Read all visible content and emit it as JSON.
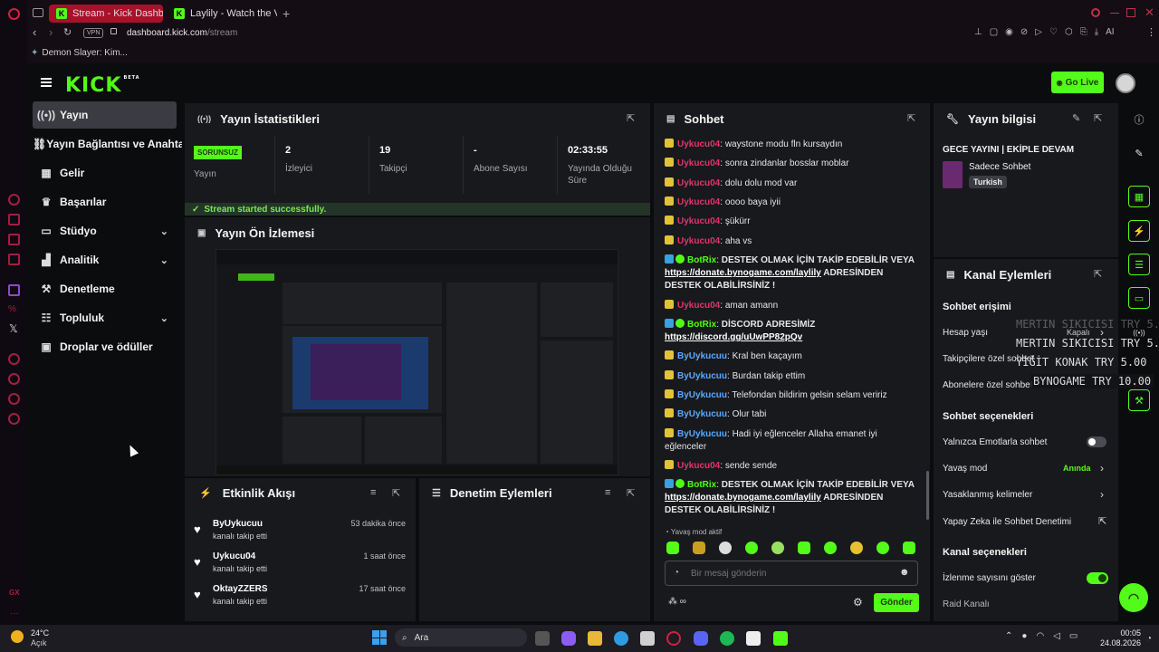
{
  "browser": {
    "tabs": [
      {
        "label": "Stream - Kick Dashboard",
        "active": true
      },
      {
        "label": "Laylily - Watch the VOD on",
        "active": false
      }
    ],
    "new_tab": "+",
    "address": {
      "vpn": "VPN",
      "domain": "dashboard.kick.com",
      "path": "/stream"
    },
    "bookmark": "Demon Slayer: Kim...",
    "ai_label": "AI"
  },
  "header": {
    "logo": "KICK",
    "beta": "BETA",
    "go_live": "Go Live"
  },
  "sidebar": {
    "items": [
      {
        "label": "Yayın",
        "icon": "broadcast-icon",
        "active": true
      },
      {
        "label": "Yayın Bağlantısı ve Anahtar",
        "icon": "link-icon"
      },
      {
        "label": "Gelir",
        "icon": "revenue-icon"
      },
      {
        "label": "Başarılar",
        "icon": "trophy-icon"
      },
      {
        "label": "Stüdyo",
        "icon": "studio-icon",
        "expandable": true
      },
      {
        "label": "Analitik",
        "icon": "analytics-icon",
        "expandable": true
      },
      {
        "label": "Denetleme",
        "icon": "moderation-icon"
      },
      {
        "label": "Topluluk",
        "icon": "community-icon",
        "expandable": true
      },
      {
        "label": "Droplar ve ödüller",
        "icon": "drops-icon"
      }
    ]
  },
  "stats": {
    "title": "Yayın İstatistikleri",
    "status_badge": "SORUNSUZ",
    "cells": [
      {
        "value": "",
        "label": "Yayın"
      },
      {
        "value": "2",
        "label": "İzleyici"
      },
      {
        "value": "19",
        "label": "Takipçi"
      },
      {
        "value": "-",
        "label": "Abone Sayısı"
      },
      {
        "value": "02:33:55",
        "label": "Yayında Olduğu Süre"
      }
    ],
    "success_msg": "Stream started successfully."
  },
  "preview": {
    "title": "Yayın Ön İzlemesi"
  },
  "activity": {
    "title": "Etkinlik Akışı",
    "items": [
      {
        "name": "ByUykucuu",
        "action": "kanalı takip etti",
        "time": "53 dakika önce"
      },
      {
        "name": "Uykucu04",
        "action": "kanalı takip etti",
        "time": "1 saat önce"
      },
      {
        "name": "OktayZZERS",
        "action": "kanalı takip etti",
        "time": "17 saat önce"
      }
    ]
  },
  "mod_actions": {
    "title": "Denetim Eylemleri"
  },
  "chat": {
    "title": "Sohbet",
    "messages": [
      {
        "user": "Uykucu04",
        "text": "waystone modu fln kursaydın"
      },
      {
        "user": "Uykucu04",
        "text": "sonra zindanlar bosslar moblar"
      },
      {
        "user": "Uykucu04",
        "text": "dolu dolu mod var"
      },
      {
        "user": "Uykucu04",
        "text": "oooo baya iyii"
      },
      {
        "user": "Uykucu04",
        "text": "şükürr"
      },
      {
        "user": "Uykucu04",
        "text": "aha vs"
      },
      {
        "user": "BotRix",
        "text": "DESTEK OLMAK İÇİN TAKİP EDEBİLİR VEYA ",
        "link": "https://donate.bynogame.com/laylily",
        "after": " ADRESİNDEN DESTEK OLABİLİRSİNİZ !"
      },
      {
        "user": "Uykucu04",
        "text": "aman amann"
      },
      {
        "user": "BotRix",
        "text": "DİSCORD ADRESİMİZ ",
        "link": "https://discord.gg/uUwPP82pQv",
        "after": ""
      },
      {
        "user": "ByUykucuu",
        "text": "Kral ben kaçayım"
      },
      {
        "user": "ByUykucuu",
        "text": "Burdan takip ettim"
      },
      {
        "user": "ByUykucuu",
        "text": "Telefondan bildirim gelsin selam veririz"
      },
      {
        "user": "ByUykucuu",
        "text": "Olur tabi"
      },
      {
        "user": "ByUykucuu",
        "text": "Hadi iyi eğlenceler Allaha emanet iyi eğlenceler"
      },
      {
        "user": "Uykucu04",
        "text": "sende sende"
      },
      {
        "user": "BotRix",
        "text": "DESTEK OLMAK İÇİN TAKİP EDEBİLİR VEYA ",
        "link": "https://donate.bynogame.com/laylily",
        "after": " ADRESİNDEN DESTEK OLABİLİRSİNİZ !"
      }
    ],
    "slow_mode": "Yavaş mod aktif",
    "placeholder": "Bir mesaj gönderin",
    "send": "Gönder"
  },
  "stream_info": {
    "title": "Yayın bilgisi",
    "stream_title": "GECE YAYINI | EKİPLE DEVAM",
    "category": "Sadece Sohbet",
    "language": "Turkish"
  },
  "channel_actions": {
    "title": "Kanal Eylemleri",
    "chat_access": "Sohbet erişimi",
    "account_age": "Hesap yaşı",
    "account_age_value": "Kapalı",
    "followers_only": "Takipçilere özel sohbet",
    "subs_only": "Abonelere özel sohbet",
    "chat_options": "Sohbet seçenekleri",
    "emotes_only": "Yalnızca Emotlarla sohbet",
    "slow_mode": "Yavaş mod",
    "slow_mode_value": "Anında",
    "banned_words": "Yasaklanmış kelimeler",
    "ai_moderation": "Yapay Zeka ile Sohbet Denetimi",
    "channel_options": "Kanal seçenekleri",
    "show_viewers": "İzlenme sayısını göster",
    "raid": "Raid Kanalı"
  },
  "donation_overlay": [
    "MERTIN SIKICISI  TRY 5.00",
    "MERTIN SIKICISI  TRY 5.00",
    "YİĞİT KONAK  TRY 5.00",
    "BYNOGAME  TRY 10.00"
  ],
  "taskbar": {
    "weather_temp": "24°C",
    "weather_desc": "Açık",
    "search": "Ara",
    "time": "00:05",
    "date": "24.08.2026"
  },
  "colors": {
    "accent": "#53fc18",
    "bg": "#0b0c0e",
    "panel": "#18191c"
  }
}
